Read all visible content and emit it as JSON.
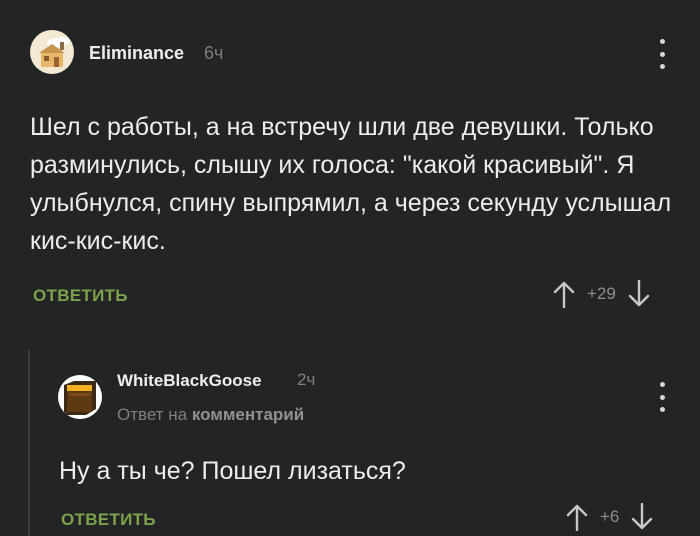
{
  "comments": [
    {
      "username": "Eliminance",
      "time": "6ч",
      "text": "Шел с работы, а на встречу шли две девушки. Только разминулись, слышу их голоса: \"какой красивый\". Я улыбнулся, спину выпрямил, а через секунду услышал кис-кис-кис.",
      "reply_label": "ОТВЕТИТЬ",
      "rating": "+29",
      "icons": {
        "avatar": "house-icon",
        "menu": "more-vertical-icon",
        "up": "arrow-up-icon",
        "down": "arrow-down-icon"
      }
    },
    {
      "username": "WhiteBlackGoose",
      "time": "2ч",
      "reply_prefix": "Ответ на",
      "reply_link": "комментарий",
      "text": "Ну а ты че? Пошел лизаться?",
      "reply_label": "ОТВЕТИТЬ",
      "rating": "+6",
      "icons": {
        "avatar": "box-icon",
        "menu": "more-vertical-icon",
        "up": "arrow-up-icon",
        "down": "arrow-down-icon"
      }
    }
  ],
  "colors": {
    "background": "#232425",
    "accent": "#7aa34b",
    "muted": "#7d7f82"
  }
}
